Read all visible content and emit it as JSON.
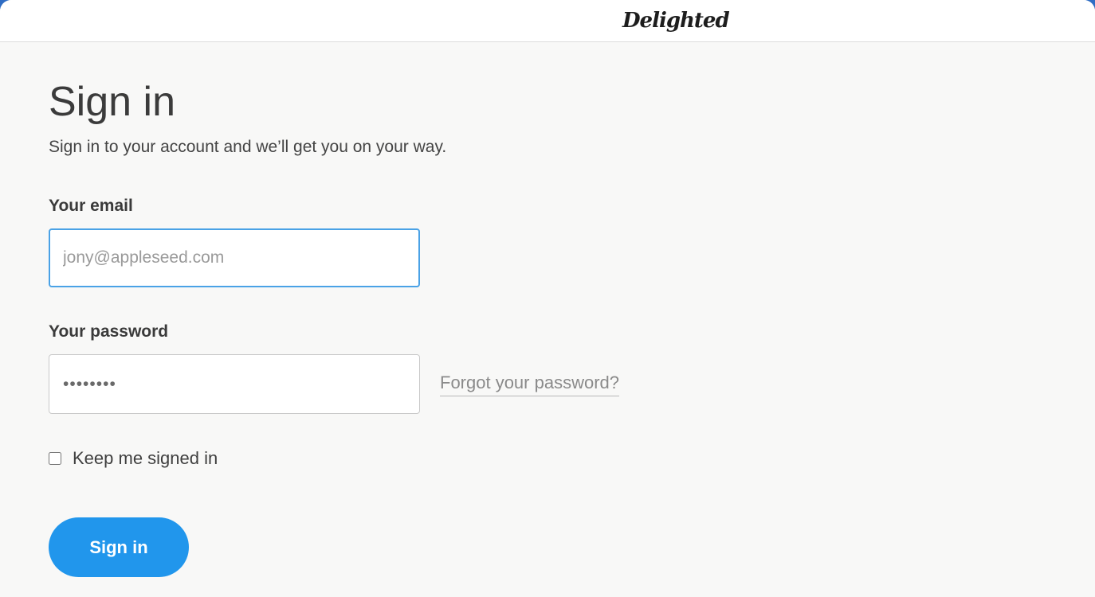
{
  "header": {
    "logo_text": "Delighted"
  },
  "main": {
    "title": "Sign in",
    "subtitle": "Sign in to your account and we’ll get you on your way."
  },
  "form": {
    "email_label": "Your email",
    "email_placeholder": "jony@appleseed.com",
    "email_value": "",
    "password_label": "Your password",
    "password_value": "••••••••",
    "forgot_link": "Forgot your password?",
    "keep_signed_in_label": "Keep me signed in",
    "keep_signed_in_checked": false,
    "submit_label": "Sign in"
  },
  "colors": {
    "accent": "#2196ec",
    "focus_border": "#4aa2e6",
    "background": "#f8f8f7"
  }
}
